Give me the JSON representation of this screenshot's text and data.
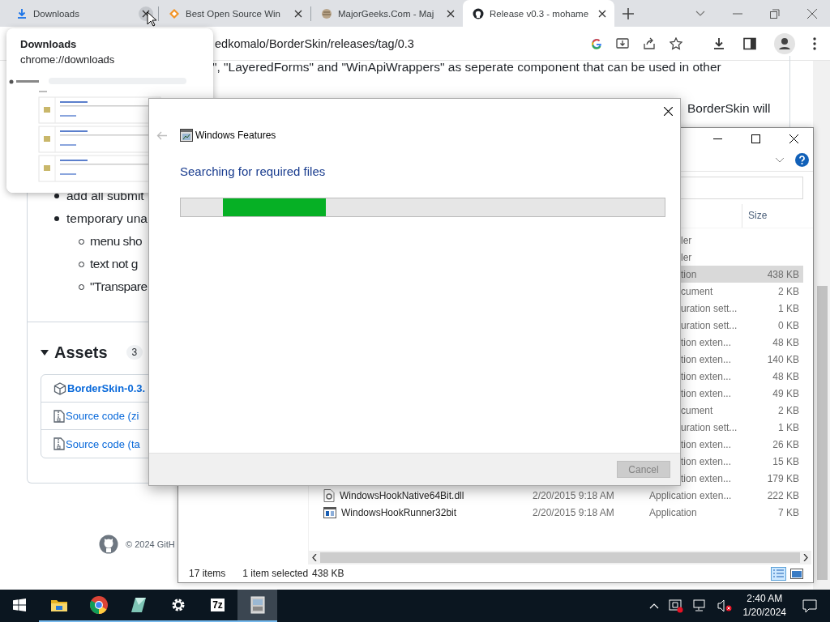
{
  "browser": {
    "tabs": [
      {
        "title": "Downloads",
        "selected": false,
        "close_hovered": true
      },
      {
        "title": "Best Open Source Win",
        "selected": false,
        "close_hovered": false
      },
      {
        "title": "MajorGeeks.Com - Maj",
        "selected": false,
        "close_hovered": false
      },
      {
        "title": "Release v0.3 - mohame",
        "selected": true,
        "close_hovered": false
      }
    ],
    "address": "edkomalo/BorderSkin/releases/tag/0.3",
    "page": {
      "line_1": "\", \"LayeredForms\" and \"WinApiWrappers\" as seperate component that can be used in other",
      "line_2": "BorderSkin will",
      "bullets": [
        {
          "text": "add all submit"
        },
        {
          "text": "temporary una",
          "children": [
            {
              "text": "menu sho"
            },
            {
              "text": "text not g"
            },
            {
              "text": "\"Transpare"
            }
          ]
        }
      ],
      "assets": {
        "title": "Assets",
        "count": "3",
        "expanded": true,
        "items": [
          {
            "kind": "package",
            "label": "BorderSkin-0.3."
          },
          {
            "kind": "archive",
            "label": "Source code (zi"
          },
          {
            "kind": "archive",
            "label": "Source code (ta"
          }
        ]
      },
      "footer": "© 2024 GitH"
    },
    "popup": {
      "title": "Downloads",
      "url": "chrome://downloads"
    }
  },
  "explorer": {
    "columns": [
      {
        "label": "Size"
      }
    ],
    "rows": [
      {
        "type": "ler",
        "selected": false
      },
      {
        "type": "ler",
        "selected": false
      },
      {
        "type": "tion",
        "size": "438 KB",
        "selected": true
      },
      {
        "type": "cument",
        "size": "2 KB",
        "selected": false
      },
      {
        "type": "uration sett...",
        "size": "1 KB",
        "selected": false
      },
      {
        "type": "uration sett...",
        "size": "0 KB",
        "selected": false
      },
      {
        "type": "tion exten...",
        "size": "48 KB",
        "selected": false
      },
      {
        "type": "tion exten...",
        "size": "140 KB",
        "selected": false
      },
      {
        "type": "tion exten...",
        "size": "48 KB",
        "selected": false
      },
      {
        "type": "tion exten...",
        "size": "49 KB",
        "selected": false
      },
      {
        "type": "cument",
        "size": "2 KB",
        "selected": false
      },
      {
        "type": "uration sett...",
        "size": "1 KB",
        "selected": false
      },
      {
        "type": "tion exten...",
        "size": "26 KB",
        "selected": false
      },
      {
        "type": "tion exten...",
        "size": "15 KB",
        "selected": false
      },
      {
        "type": "tion exten...",
        "size": "179 KB",
        "selected": false
      },
      {
        "kind": "dll",
        "name": "WindowsHookNative64Bit.dll",
        "date": "2/20/2015 9:18 AM",
        "type": "Application exten...",
        "size": "222 KB",
        "selected": false
      },
      {
        "kind": "exe",
        "name": "WindowsHookRunner32bit",
        "date": "2/20/2015 9:18 AM",
        "type": "Application",
        "size": "7 KB",
        "selected": false
      }
    ],
    "status": {
      "items": "17 items",
      "selection": "1 item selected",
      "size": "438 KB"
    }
  },
  "dialog": {
    "title": "Windows Features",
    "heading": "Searching for required files",
    "progress": {
      "indeterminate": true
    },
    "cancel": {
      "label": "Cancel",
      "disabled": true
    }
  },
  "taskbar": {
    "apps": [
      {
        "kind": "folder",
        "running": true,
        "active": false
      },
      {
        "kind": "circle",
        "running": true,
        "active": false
      },
      {
        "kind": "prism",
        "running": true,
        "active": false
      },
      {
        "kind": "gear",
        "running": true,
        "active": false
      },
      {
        "kind": "tile",
        "text": "7z",
        "running": true,
        "active": false
      },
      {
        "kind": "features",
        "running": true,
        "active": true
      }
    ],
    "time": "2:40 AM",
    "date": "1/20/2024"
  }
}
